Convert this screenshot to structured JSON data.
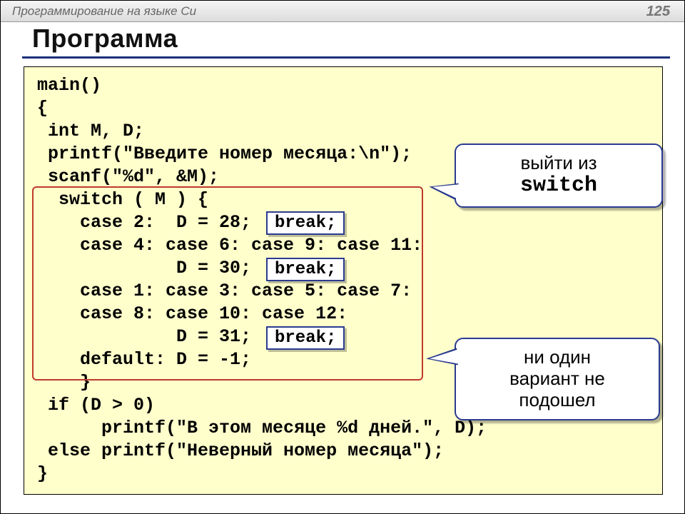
{
  "header": {
    "course": "Программирование на языке Си",
    "page": "125",
    "star": "*"
  },
  "title": "Программа",
  "code": {
    "l1": "main()",
    "l2": "{",
    "l3": " int M, D;",
    "l4": " printf(\"Введите номер месяца:\\n\");",
    "l5": " scanf(\"%d\", &M);",
    "l6": "  switch ( M ) {",
    "l7": "    case 2:  D = 28;",
    "l8": "    case 4: case 6: case 9: case 11:",
    "l9": "             D = 30;",
    "l10": "    case 1: case 3: case 5: case 7:",
    "l11": "    case 8: case 10: case 12:",
    "l12": "             D = 31;",
    "l13": "    default: D = -1;",
    "l14": "    }",
    "l15": " if (D > 0)",
    "l16": "      printf(\"В этом месяце %d дней.\", D);",
    "l17": " else printf(\"Неверный номер месяца\");",
    "l18": "}"
  },
  "breaks": {
    "b1": "break;",
    "b2": "break;",
    "b3": "break;"
  },
  "callouts": {
    "c1_line1": "выйти из",
    "c1_line2": "switch",
    "c2_line1": "ни один",
    "c2_line2": "вариант не",
    "c2_line3": "подошел"
  }
}
